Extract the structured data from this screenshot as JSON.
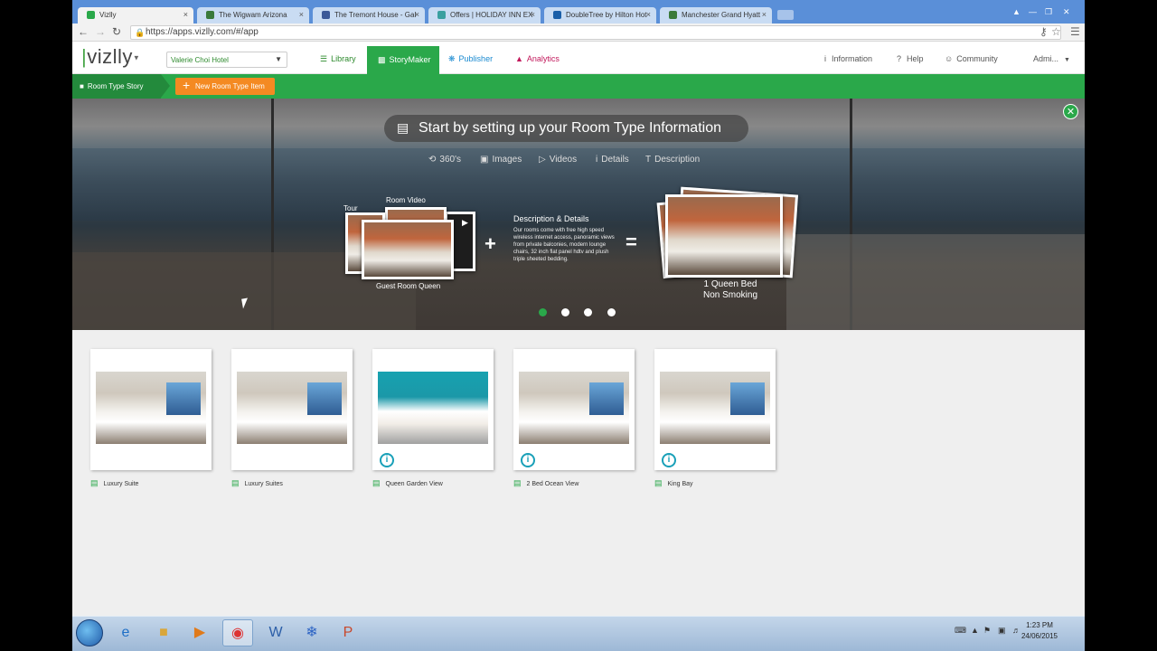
{
  "browser": {
    "tabs": [
      {
        "title": "Vizlly",
        "color": "#2aa84a"
      },
      {
        "title": "The Wigwam Arizona",
        "color": "#3a7a3a"
      },
      {
        "title": "The Tremont House - Gal",
        "color": "#3b5998"
      },
      {
        "title": "Offers | HOLIDAY INN EX",
        "color": "#3aa0a0"
      },
      {
        "title": "DoubleTree by Hilton Hot",
        "color": "#1a5fa8"
      },
      {
        "title": "Manchester Grand Hyatt",
        "color": "#3a7a3a"
      }
    ],
    "close_glyph": "×",
    "url": "https://apps.vizlly.com/#/app"
  },
  "app": {
    "logo_text": "vizlly",
    "hotel_select": "Valerie Choi Hotel",
    "nav": {
      "library": "Library",
      "storymaker": "StoryMaker",
      "publisher": "Publisher",
      "analytics": "Analytics"
    },
    "right_nav": {
      "information": "Information",
      "help": "Help",
      "community": "Community",
      "admin": "Admi..."
    },
    "subnav": {
      "crumb": "Room Type Story",
      "new_item": "New Room Type Item"
    }
  },
  "hero": {
    "title": "Start by setting up your Room Type Information",
    "tabs": [
      "360's",
      "Images",
      "Videos",
      "Details",
      "Description"
    ],
    "diagram": {
      "tour_label": "Tour",
      "video_label": "Room Video",
      "room_name": "Guest Room Queen",
      "plus": "+",
      "equals": "=",
      "desc_title": "Description & Details",
      "desc_text": "Our rooms come with free high speed wireless internet access, panoramic views from private balconies, modern lounge chairs, 32 inch flat panel hdtv and plush triple sheeted bedding.",
      "result_line1": "1 Queen Bed",
      "result_line2": "Non Smoking"
    },
    "active_dot": 0
  },
  "cards": [
    {
      "name": "Luxury Suite",
      "info": false
    },
    {
      "name": "Luxury Suites",
      "info": false
    },
    {
      "name": "Queen Garden View",
      "info": true
    },
    {
      "name": "2 Bed Ocean View",
      "info": true
    },
    {
      "name": "King Bay",
      "info": true
    }
  ],
  "taskbar": {
    "time": "1:23 PM",
    "date": "24/06/2015"
  }
}
